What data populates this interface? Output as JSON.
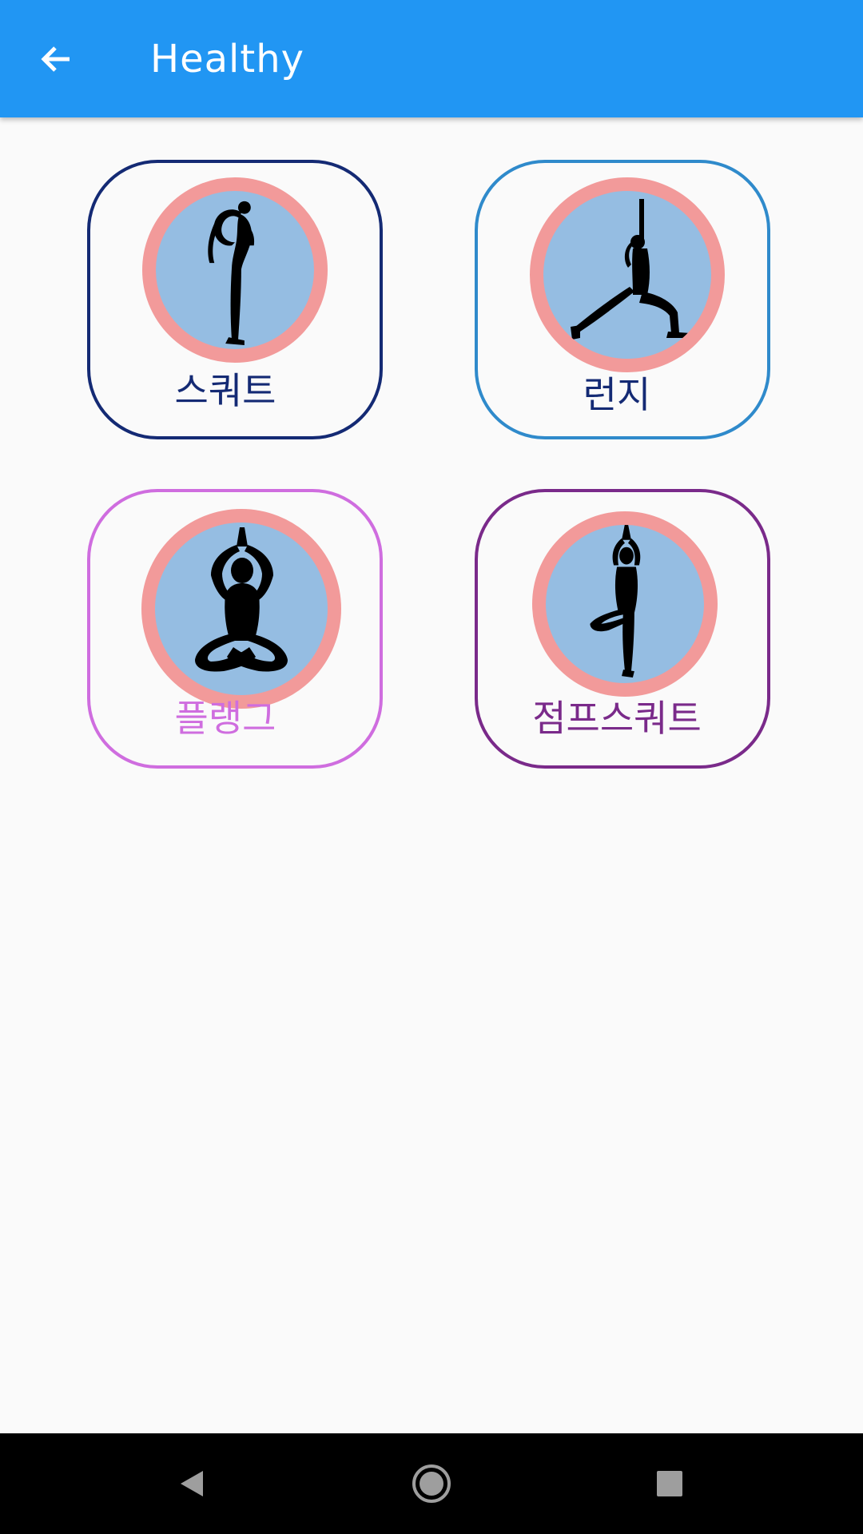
{
  "app_bar": {
    "title": "Healthy",
    "background": "#2196f3",
    "back_icon": "arrow-left-icon"
  },
  "cards": [
    {
      "label": "스쿼트",
      "border_color": "#142a74",
      "text_color": "#142a74",
      "figure": "dancer-pose-silhouette"
    },
    {
      "label": "런지",
      "border_color": "#2f8acb",
      "text_color": "#142a74",
      "figure": "warrior-pose-silhouette"
    },
    {
      "label": "플랭그",
      "border_color": "#cf6ddf",
      "text_color": "#cf6ddf",
      "figure": "lotus-pose-silhouette"
    },
    {
      "label": "점프스쿼트",
      "border_color": "#7a2a8a",
      "text_color": "#7a2a8a",
      "figure": "tree-pose-silhouette"
    }
  ],
  "icon_colors": {
    "ring": "#f29a9a",
    "fill": "#95bde2",
    "figure": "#000000"
  },
  "nav_bar": {
    "back_icon": "triangle-back-icon",
    "home_icon": "circle-home-icon",
    "recents_icon": "square-recents-icon"
  }
}
